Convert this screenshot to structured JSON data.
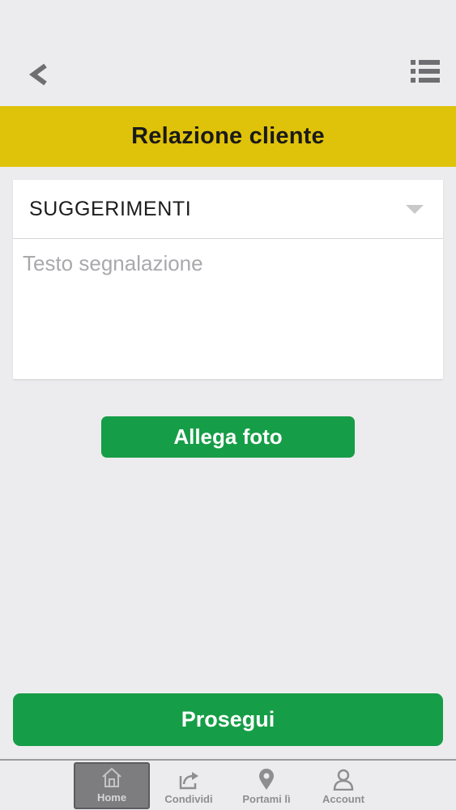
{
  "header": {
    "back_icon": "chevron-left-icon",
    "menu_icon": "list-icon",
    "title": "Relazione cliente"
  },
  "form": {
    "category": {
      "selected": "SUGGERIMENTI",
      "icon": "dropdown-triangle-icon"
    },
    "report_text": {
      "value": "",
      "placeholder": "Testo segnalazione"
    },
    "attach_photo_label": "Allega foto",
    "continue_label": "Prosegui"
  },
  "tabbar": {
    "items": [
      {
        "label": "Home",
        "icon": "home-icon",
        "active": true
      },
      {
        "label": "Condividi",
        "icon": "share-icon",
        "active": false
      },
      {
        "label": "Portami lì",
        "icon": "map-pin-icon",
        "active": false
      },
      {
        "label": "Account",
        "icon": "user-icon",
        "active": false
      }
    ]
  },
  "colors": {
    "background": "#ececee",
    "title_band": "#dfc20a",
    "primary_button": "#169d47",
    "active_tab": "#7d7d80"
  }
}
